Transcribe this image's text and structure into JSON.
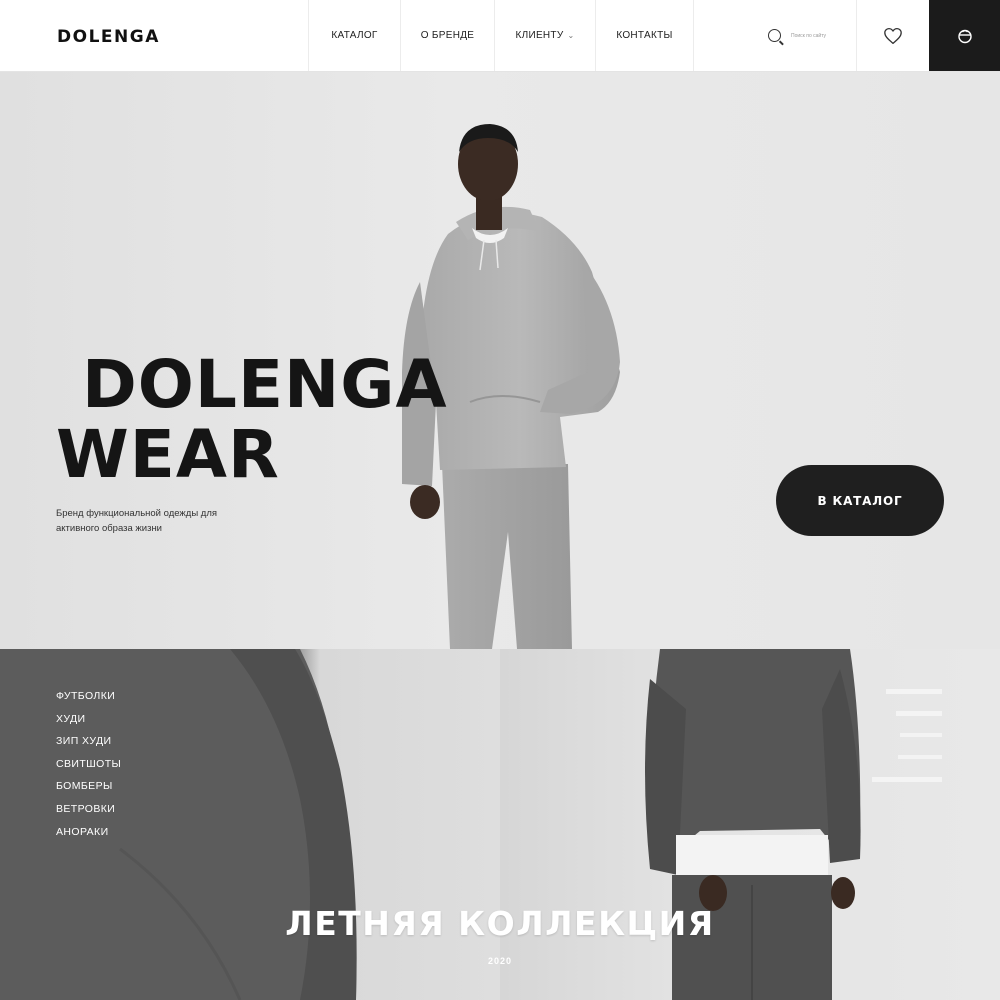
{
  "header": {
    "logo": "DOLENGA",
    "nav": [
      {
        "label": "КАТАЛОГ",
        "dropdown": false
      },
      {
        "label": "О БРЕНДЕ",
        "dropdown": false
      },
      {
        "label": "КЛИЕНТУ",
        "dropdown": true
      },
      {
        "label": "КОНТАКТЫ",
        "dropdown": false
      }
    ],
    "search": {
      "placeholder": "Поиск по сайту",
      "icon": "search-icon"
    },
    "favorites_icon": "heart-icon",
    "cart_icon": "cart-icon"
  },
  "hero": {
    "title_line1": "DOLENGA",
    "title_line2": "WEAR",
    "subtitle": "Бренд функциональной одежды для активного образа жизни",
    "cta_label": "В КАТАЛОГ"
  },
  "categories": [
    "ФУТБОЛКИ",
    "ХУДИ",
    "ЗИП ХУДИ",
    "СВИТШОТЫ",
    "БОМБЕРЫ",
    "ВЕТРОВКИ",
    "АНОРАКИ"
  ],
  "collection": {
    "title": "ЛЕТНЯЯ КОЛЛЕКЦИЯ",
    "year": "2020"
  },
  "colors": {
    "accent_dark": "#1b1b1b",
    "background": "#e6e6e6",
    "text": "#111111"
  }
}
